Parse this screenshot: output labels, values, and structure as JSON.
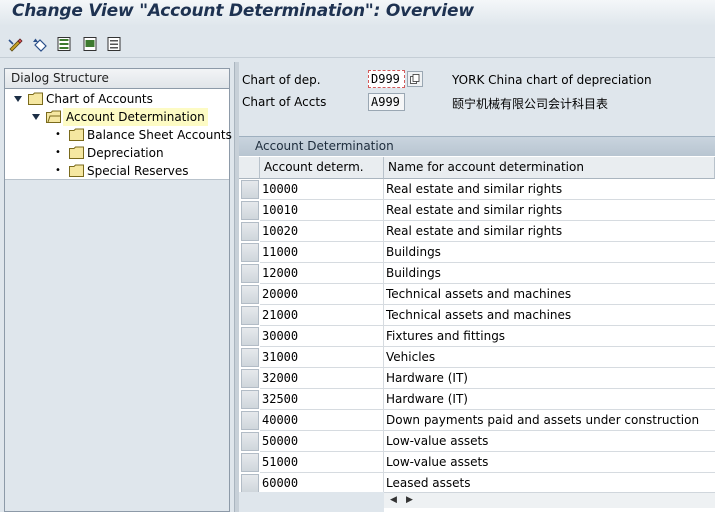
{
  "window": {
    "title": "Change View \"Account Determination\": Overview"
  },
  "toolbar": {
    "buttons": [
      {
        "icon": "change-display-icon"
      },
      {
        "icon": "undo-icon"
      },
      {
        "icon": "select-all-icon"
      },
      {
        "icon": "select-block-icon"
      },
      {
        "icon": "deselect-all-icon"
      }
    ]
  },
  "dialog_structure": {
    "heading": "Dialog Structure",
    "items": [
      {
        "label": "Chart of Accounts",
        "level": 0,
        "expanded": true
      },
      {
        "label": "Account Determination",
        "level": 1,
        "expanded": true,
        "selected": true
      },
      {
        "label": "Balance Sheet Accounts",
        "level": 2
      },
      {
        "label": "Depreciation",
        "level": 2
      },
      {
        "label": "Special Reserves",
        "level": 2
      }
    ]
  },
  "header": {
    "chart_of_dep_label": "Chart of dep.",
    "chart_of_dep_value": "D999",
    "chart_of_dep_text": "YORK China chart of depreciation",
    "chart_of_accts_label": "Chart of Accts",
    "chart_of_accts_value": "A999",
    "chart_of_accts_text": "颐宁机械有限公司会计科目表"
  },
  "table": {
    "title": "Account Determination",
    "columns": [
      "Account determ.",
      "Name for account determination"
    ],
    "rows": [
      {
        "code": "10000",
        "name": "Real estate and similar rights"
      },
      {
        "code": "10010",
        "name": "Real estate and similar rights"
      },
      {
        "code": "10020",
        "name": "Real estate and similar rights"
      },
      {
        "code": "11000",
        "name": "Buildings"
      },
      {
        "code": "12000",
        "name": "Buildings"
      },
      {
        "code": "20000",
        "name": "Technical assets and machines"
      },
      {
        "code": "21000",
        "name": "Technical assets and machines"
      },
      {
        "code": "30000",
        "name": "Fixtures and fittings"
      },
      {
        "code": "31000",
        "name": "Vehicles"
      },
      {
        "code": "32000",
        "name": "Hardware (IT)"
      },
      {
        "code": "32500",
        "name": "Hardware (IT)"
      },
      {
        "code": "40000",
        "name": "Down payments paid and assets under construction"
      },
      {
        "code": "50000",
        "name": "Low-value assets"
      },
      {
        "code": "51000",
        "name": "Low-value assets"
      },
      {
        "code": "60000",
        "name": "Leased assets"
      }
    ]
  },
  "colors": {
    "title_text": "#1e3251",
    "background": "#dfe6ec",
    "selected_node": "#fdfbc4"
  }
}
